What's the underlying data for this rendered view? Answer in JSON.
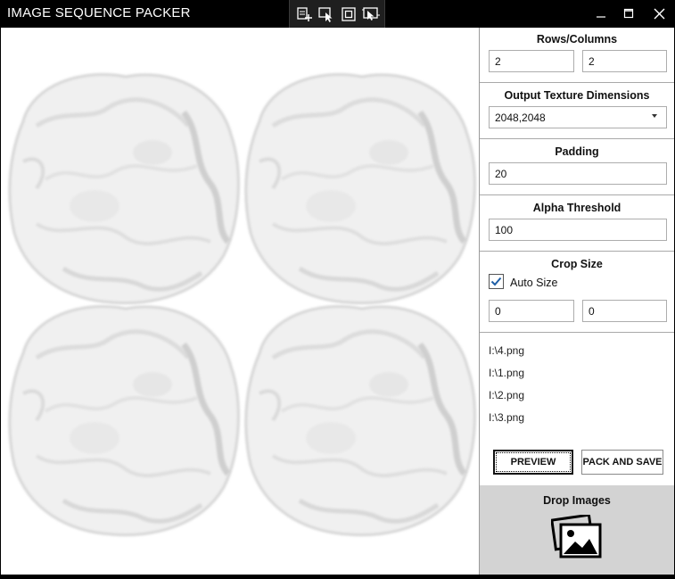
{
  "app": {
    "title": "IMAGE SEQUENCE PACKER"
  },
  "icons": {
    "toolbar": [
      "add-element-icon",
      "select-element-icon",
      "display-layout-icon",
      "track-focus-icon"
    ],
    "window": [
      "minimize-icon",
      "maximize-icon",
      "close-icon"
    ],
    "drop": "images-icon"
  },
  "rows_columns": {
    "label": "Rows/Columns",
    "rows": "2",
    "columns": "2"
  },
  "output_dimensions": {
    "label": "Output Texture Dimensions",
    "value": "2048,2048"
  },
  "padding": {
    "label": "Padding",
    "value": "20"
  },
  "alpha_threshold": {
    "label": "Alpha Threshold",
    "value": "100"
  },
  "crop_size": {
    "label": "Crop Size",
    "auto_size_label": "Auto Size",
    "auto_size_checked": true,
    "width": "0",
    "height": "0"
  },
  "files": [
    "I:\\4.png",
    "I:\\1.png",
    "I:\\2.png",
    "I:\\3.png"
  ],
  "buttons": {
    "preview": "PREVIEW",
    "pack_and_save": "PACK AND SAVE"
  },
  "drop_zone": {
    "label": "Drop Images"
  },
  "preview_grid": {
    "rows": 2,
    "columns": 2
  }
}
